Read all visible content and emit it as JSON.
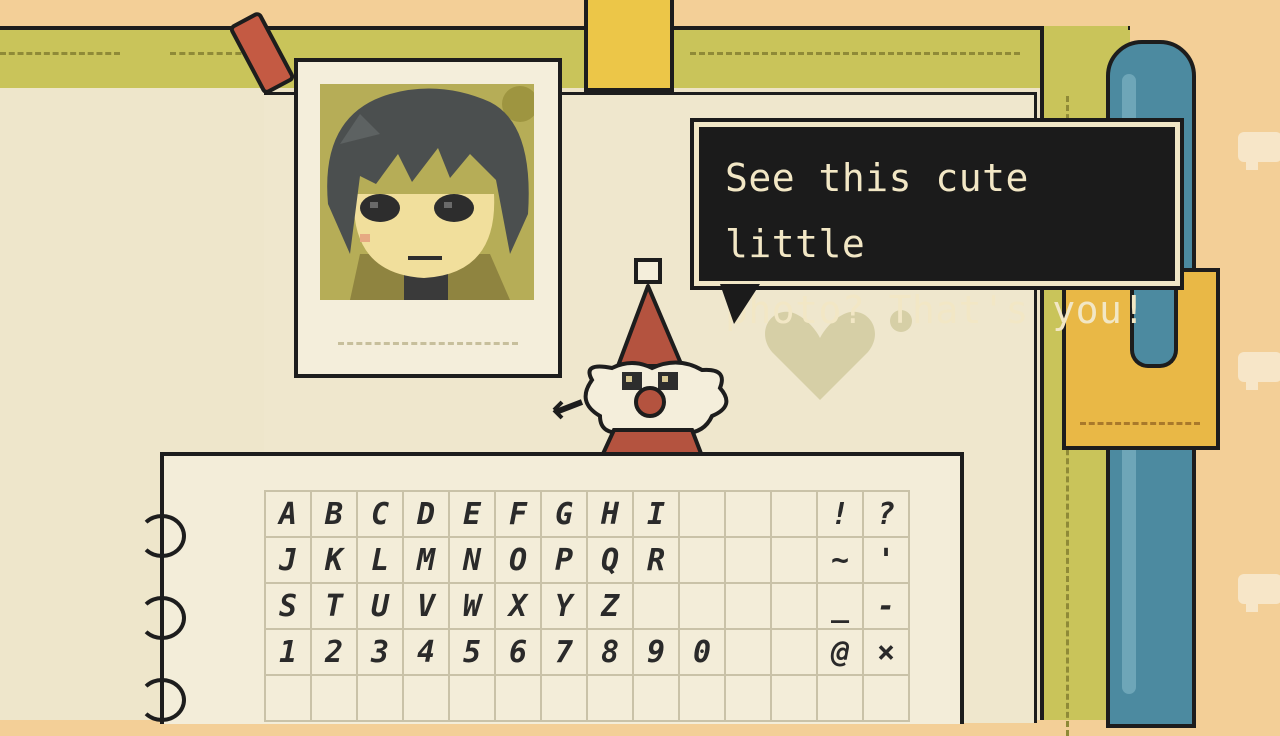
{
  "dialogue": {
    "text": "See this cute little\nphoto? That's you!"
  },
  "keyboard": {
    "rows": [
      [
        "A",
        "B",
        "C",
        "D",
        "E",
        "F",
        "G",
        "H",
        "I",
        "",
        "",
        "",
        "!",
        "?"
      ],
      [
        "J",
        "K",
        "L",
        "M",
        "N",
        "O",
        "P",
        "Q",
        "R",
        "",
        "",
        "",
        "~",
        "'"
      ],
      [
        "S",
        "T",
        "U",
        "V",
        "W",
        "X",
        "Y",
        "Z",
        "",
        "",
        "",
        "",
        "_",
        "-"
      ],
      [
        "1",
        "2",
        "3",
        "4",
        "5",
        "6",
        "7",
        "8",
        "9",
        "0",
        "",
        "",
        "@",
        "×"
      ],
      [
        "",
        "",
        "",
        "",
        "",
        "",
        "",
        "",
        "",
        "",
        "",
        "",
        "",
        ""
      ]
    ]
  },
  "colors": {
    "background": "#f3cf97",
    "binder": "#c9c45a",
    "paper": "#efe7cd",
    "bubble": "#1b1b1b",
    "bubble_text": "#f2e7c5",
    "hat": "#b4533f",
    "strap": "#4c8aa0",
    "pocket": "#e9b846"
  }
}
